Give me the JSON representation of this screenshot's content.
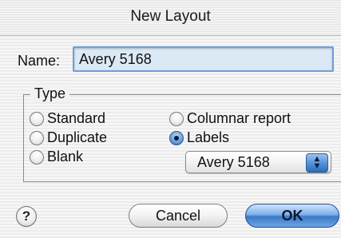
{
  "window": {
    "title": "New Layout"
  },
  "name_field": {
    "label": "Name:",
    "value": "Avery 5168"
  },
  "type_group": {
    "legend": "Type",
    "options": [
      {
        "label": "Standard",
        "checked": false
      },
      {
        "label": "Duplicate",
        "checked": false
      },
      {
        "label": "Blank",
        "checked": false
      },
      {
        "label": "Columnar report",
        "checked": false
      },
      {
        "label": "Labels",
        "checked": true
      }
    ],
    "label_popup": {
      "selected": "Avery 5168"
    }
  },
  "buttons": {
    "help": "?",
    "cancel": "Cancel",
    "ok": "OK"
  }
}
